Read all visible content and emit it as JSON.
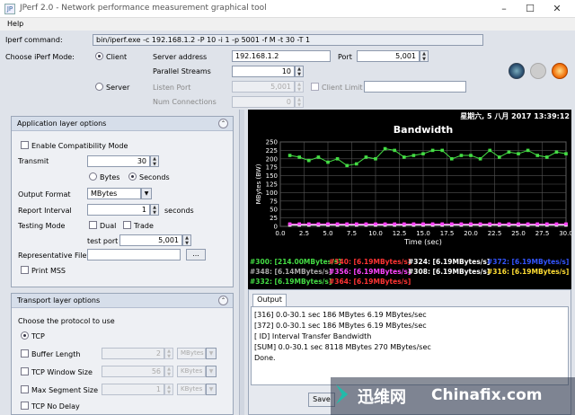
{
  "window": {
    "title": "JPerf 2.0 - Network performance measurement graphical tool",
    "logo": "JP",
    "minimize": "–",
    "maximize": "☐",
    "close": "✕"
  },
  "menu": {
    "help": "Help"
  },
  "config": {
    "command_label": "Iperf command:",
    "command_value": "bin/iperf.exe -c 192.168.1.2 -P 10 -i 1 -p 5001 -f M -t 30 -T 1",
    "mode_label": "Choose iPerf Mode:",
    "client_label": "Client",
    "server_label": "Server",
    "server_address_label": "Server address",
    "server_address_value": "192.168.1.2",
    "port_label": "Port",
    "port_value": "5,001",
    "parallel_label": "Parallel Streams",
    "parallel_value": "10",
    "listen_port_label": "Listen Port",
    "listen_port_value": "5,001",
    "client_limit_label": "Client Limit",
    "num_conn_label": "Num Connections",
    "num_conn_value": "0"
  },
  "app_options": {
    "title": "Application layer options",
    "compat_label": "Enable Compatibility Mode",
    "transmit_label": "Transmit",
    "transmit_value": "30",
    "bytes_label": "Bytes",
    "seconds_label": "Seconds",
    "output_format_label": "Output Format",
    "output_format_value": "MBytes",
    "report_interval_label": "Report Interval",
    "report_interval_value": "1",
    "seconds_unit": "seconds",
    "testing_mode_label": "Testing Mode",
    "dual_label": "Dual",
    "trade_label": "Trade",
    "test_port_label": "test port",
    "test_port_value": "5,001",
    "rep_file_label": "Representative File",
    "browse_label": "...",
    "print_mss_label": "Print MSS"
  },
  "transport": {
    "title": "Transport layer options",
    "protocol_label": "Choose the protocol to use",
    "tcp_label": "TCP",
    "buffer_label": "Buffer Length",
    "buffer_value": "2",
    "buffer_unit": "MBytes",
    "window_label": "TCP Window Size",
    "window_value": "56",
    "window_unit": "KBytes",
    "mss_label": "Max Segment Size",
    "mss_value": "1",
    "mss_unit": "KBytes",
    "nodelay_label": "TCP No Delay"
  },
  "chart_header": {
    "datetime": "星期六, 5 八月 2017 13:39:12"
  },
  "chart_data": {
    "type": "line",
    "title": "Bandwidth",
    "xlabel": "Time (sec)",
    "ylabel": "MBytes (BW)",
    "xlim": [
      0,
      30
    ],
    "ylim": [
      0,
      250
    ],
    "x_ticks": [
      "0.0",
      "2.5",
      "5.0",
      "7.5",
      "10.0",
      "12.5",
      "15.0",
      "17.5",
      "20.0",
      "22.5",
      "25.0",
      "27.5",
      "30.0"
    ],
    "y_ticks": [
      "0",
      "25",
      "50",
      "75",
      "100",
      "125",
      "150",
      "175",
      "200",
      "225",
      "250"
    ],
    "grid": true,
    "background": "#000000",
    "series": [
      {
        "name": "#300",
        "color": "#44dd44",
        "x": [
          1,
          2,
          3,
          4,
          5,
          6,
          7,
          8,
          9,
          10,
          11,
          12,
          13,
          14,
          15,
          16,
          17,
          18,
          19,
          20,
          21,
          22,
          23,
          24,
          25,
          26,
          27,
          28,
          29,
          30
        ],
        "y": [
          210,
          205,
          195,
          205,
          190,
          200,
          180,
          185,
          205,
          200,
          230,
          225,
          205,
          210,
          215,
          225,
          225,
          200,
          210,
          210,
          200,
          225,
          205,
          220,
          215,
          225,
          210,
          205,
          220,
          215
        ]
      },
      {
        "name": "#340",
        "color": "#ff3333",
        "x": [
          1,
          2,
          3,
          4,
          5,
          6,
          7,
          8,
          9,
          10,
          11,
          12,
          13,
          14,
          15,
          16,
          17,
          18,
          19,
          20,
          21,
          22,
          23,
          24,
          25,
          26,
          27,
          28,
          29,
          30
        ],
        "y": [
          6,
          6,
          6,
          6,
          6,
          6,
          6,
          6,
          6,
          6,
          6,
          6,
          6,
          6,
          6,
          6,
          6,
          6,
          6,
          6,
          6,
          6,
          6,
          6,
          6,
          6,
          6,
          6,
          6,
          6
        ]
      },
      {
        "name": "#324",
        "color": "#ffffff",
        "x": [
          1,
          2,
          3,
          4,
          5,
          6,
          7,
          8,
          9,
          10,
          11,
          12,
          13,
          14,
          15,
          16,
          17,
          18,
          19,
          20,
          21,
          22,
          23,
          24,
          25,
          26,
          27,
          28,
          29,
          30
        ],
        "y": [
          4,
          4,
          4,
          4,
          4,
          4,
          4,
          4,
          4,
          4,
          4,
          4,
          4,
          4,
          4,
          4,
          4,
          4,
          4,
          4,
          4,
          4,
          4,
          4,
          4,
          4,
          4,
          4,
          4,
          4
        ]
      },
      {
        "name": "#356",
        "color": "#ff44ff",
        "x": [
          1,
          2,
          3,
          4,
          5,
          6,
          7,
          8,
          9,
          10,
          11,
          12,
          13,
          14,
          15,
          16,
          17,
          18,
          19,
          20,
          21,
          22,
          23,
          24,
          25,
          26,
          27,
          28,
          29,
          30
        ],
        "y": [
          7,
          7,
          7,
          7,
          7,
          7,
          7,
          7,
          7,
          7,
          7,
          7,
          7,
          7,
          7,
          7,
          7,
          7,
          7,
          7,
          7,
          7,
          7,
          7,
          7,
          7,
          7,
          7,
          7,
          7
        ]
      }
    ],
    "legend": [
      {
        "text": "#300: [214.00MBytes/s]",
        "color": "#44dd44"
      },
      {
        "text": "#340: [6.19MBytes/s]",
        "color": "#ff3333"
      },
      {
        "text": "#324: [6.19MBytes/s]",
        "color": "#ffffff"
      },
      {
        "text": "#372: [6.19MBytes/s]",
        "color": "#3355ff"
      },
      {
        "text": "#348: [6.14MBytes/s]",
        "color": "#aaaaaa"
      },
      {
        "text": "#356: [6.19MBytes/s]",
        "color": "#ff44ff"
      },
      {
        "text": "#308: [6.19MBytes/s]",
        "color": "#ffffff"
      },
      {
        "text": "#316: [6.19MBytes/s]",
        "color": "#ffdd33"
      },
      {
        "text": "#332: [6.19MBytes/s]",
        "color": "#44dd44"
      },
      {
        "text": "#364: [6.19MBytes/s]",
        "color": "#ff3333"
      }
    ]
  },
  "output": {
    "tab": "Output",
    "lines": [
      "[316]  0.0-30.1 sec   186 MBytes  6.19 MBytes/sec",
      "[372]  0.0-30.1 sec   186 MBytes  6.19 MBytes/sec",
      "[ ID] Interval       Transfer     Bandwidth",
      "[SUM]  0.0-30.1 sec  8118 MBytes   270 MBytes/sec",
      "Done."
    ],
    "save_label": "Save"
  },
  "watermark": {
    "cn": "迅维网",
    "en": "Chinafix.com",
    "corner": "KOCK"
  },
  "colors": {
    "window_bg": "#dfe3ea",
    "chart_bg": "#000000",
    "panel_head": "#d6deea"
  }
}
